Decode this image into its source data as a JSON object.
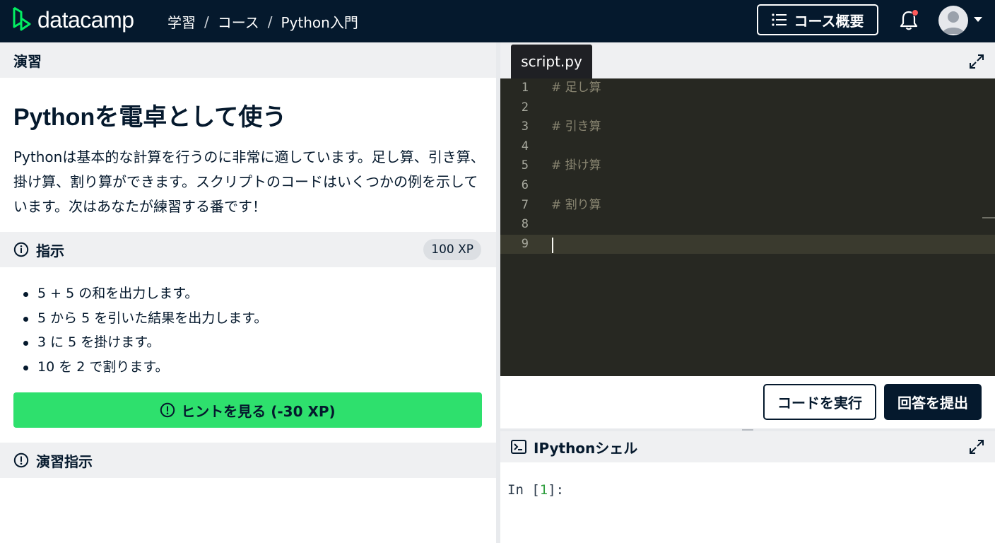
{
  "brand": {
    "name": "datacamp",
    "mark_color": "#03ef62"
  },
  "breadcrumb": [
    "学習",
    "コース",
    "Python入門"
  ],
  "breadcrumb_sep": "/",
  "header": {
    "outline_button": "コース概要",
    "has_notification": true
  },
  "exercise": {
    "section_label": "演習",
    "title": "Pythonを電卓として使う",
    "description": "Pythonは基本的な計算を行うのに非常に適しています。足し算、引き算、掛け算、割り算ができます。スクリプトのコードはいくつかの例を示しています。次はあなたが練習する番です！"
  },
  "instructions": {
    "label": "指示",
    "xp": "100 XP",
    "items": [
      "5 + 5 の和を出力します。",
      "5 から 5 を引いた結果を出力します。",
      "3 に 5 を掛けます。",
      "10 を 2 で割ります。"
    ],
    "hint_button": "ヒントを見る (-30 XP)"
  },
  "practice_section": "演習指示",
  "editor": {
    "tab": "script.py",
    "lines": [
      {
        "n": "1",
        "code": "# 足し算"
      },
      {
        "n": "2",
        "code": ""
      },
      {
        "n": "3",
        "code": "# 引き算"
      },
      {
        "n": "4",
        "code": ""
      },
      {
        "n": "5",
        "code": "# 掛け算"
      },
      {
        "n": "6",
        "code": ""
      },
      {
        "n": "7",
        "code": "# 割り算"
      },
      {
        "n": "8",
        "code": ""
      },
      {
        "n": "9",
        "code": ""
      }
    ],
    "active_line": "9"
  },
  "actions": {
    "run": "コードを実行",
    "submit": "回答を提出"
  },
  "shell": {
    "title": "IPythonシェル",
    "prompt_prefix": "In [",
    "prompt_number": "1",
    "prompt_suffix": "]:"
  },
  "colors": {
    "topbar": "#05192d",
    "hint_green": "#2ee06d",
    "editor_bg": "#272822",
    "notification_dot": "#ff5a5a"
  }
}
